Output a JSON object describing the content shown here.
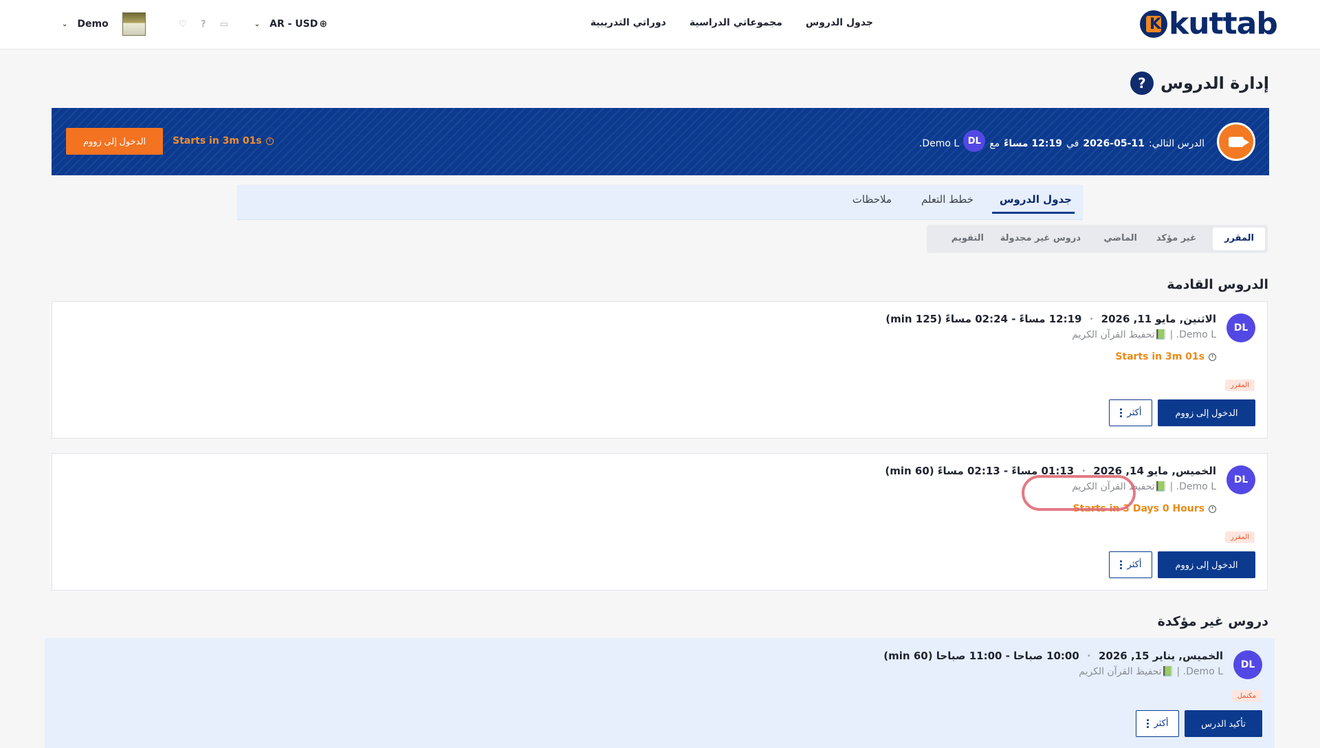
{
  "brand": {
    "name": "kuttab",
    "mark_letter": "K"
  },
  "nav": {
    "schedule": "جدول الدروس",
    "groups": "مجموعاتي الدراسية",
    "courses": "دوراتي التدريبية"
  },
  "header": {
    "locale": "AR - USD",
    "user": "Demo"
  },
  "page": {
    "title": "إدارة الدروس",
    "help": "?"
  },
  "banner": {
    "prefix": "الدرس التالي:",
    "date": "2026-05-11",
    "in_word": "في",
    "time": "12:19 مساءً",
    "with_word": "مع",
    "tutor_initials": "DL",
    "tutor": "Demo L.",
    "starts": "Starts in 3m 01s",
    "join": "الدخول إلى زووم"
  },
  "tabs": {
    "schedule": "جدول الدروس",
    "plans": "خطط التعلم",
    "notes": "ملاحظات"
  },
  "subtabs": {
    "scheduled": "المقرر",
    "unconfirmed": "غير مؤكد",
    "past": "الماضي",
    "unscheduled": "دروس غير مجدولة",
    "calendar": "التقويم"
  },
  "sections": {
    "upcoming": "الدروس القادمة",
    "unconfirmed": "دروس غير مؤكدة"
  },
  "lessons": [
    {
      "initials": "DL",
      "date": "الاثنين, مايو 11, 2026",
      "time": "12:19 مساءً - 02:24 مساءً (125 min)",
      "meta": "Demo L. | 📗تحفيظ القرآن الكريم",
      "starts": "Starts in 3m 01s",
      "status": "المقرر",
      "primary": "الدخول إلى زووم",
      "more": "أكثر"
    },
    {
      "initials": "DL",
      "date": "الخميس, مايو 14, 2026",
      "time": "01:13 مساءً - 02:13 مساءً (60 min)",
      "meta": "Demo L. | 📗تحفيظ القرآن الكريم",
      "starts": "Starts in 3 Days 0 Hours",
      "status": "المقرر",
      "primary": "الدخول إلى زووم",
      "more": "أكثر"
    },
    {
      "initials": "DL",
      "date": "الخميس, يناير 15, 2026",
      "time": "10:00 صباحا - 11:00 صباحا (60 min)",
      "meta": "Demo L. | 📗تحفيظ القرآن الكريم",
      "status": "مكتمل",
      "primary": "تأكيد الدرس",
      "more": "أكثر"
    }
  ],
  "colors": {
    "navy": "#0b3a8f",
    "orange": "#f37321",
    "avatar": "#5348e4"
  }
}
